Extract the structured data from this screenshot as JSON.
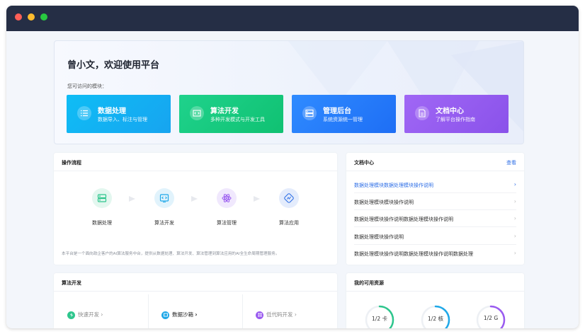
{
  "welcome": {
    "greeting": "曾小文，欢迎使用平台",
    "modules_label": "您可访问的模块："
  },
  "modules": [
    {
      "title": "数据处理",
      "desc": "数据导入、标注与管理",
      "icon": "list-icon"
    },
    {
      "title": "算法开发",
      "desc": "多种开发模式与开发工具",
      "icon": "code-icon"
    },
    {
      "title": "管理后台",
      "desc": "系统资源统一管理",
      "icon": "server-icon"
    },
    {
      "title": "文档中心",
      "desc": "了解平台操作指南",
      "icon": "document-icon"
    }
  ],
  "flow": {
    "title": "操作流程",
    "steps": [
      {
        "label": "数据处理",
        "icon": "server-icon",
        "color": "#2ec68d"
      },
      {
        "label": "算法开发",
        "icon": "code-icon",
        "color": "#1fa8e8"
      },
      {
        "label": "算法管理",
        "icon": "atom-icon",
        "color": "#9a5bf0"
      },
      {
        "label": "算法应用",
        "icon": "link-icon",
        "color": "#2f6fe6"
      }
    ],
    "description": "本平台是一个面向政企客户的AI算法服务中台，提供从数据处理、算法开发、算法管理到算法应用的AI全生命周期管理服务。"
  },
  "docs": {
    "title": "文档中心",
    "more": "查看",
    "items": [
      "数据处理模块数据处理模块操作说明",
      "数据处理模块模块操作说明",
      "数据处理模块操作说明数据处理模块操作说明",
      "数据处理模块操作说明",
      "数据处理模块操作说明数据处理模块操作说明数据处理"
    ]
  },
  "algo": {
    "title": "算法开发",
    "items": [
      {
        "label": "快速开发",
        "chevron": "›",
        "color": "#2ec68d",
        "icon": "flash-icon",
        "active": false
      },
      {
        "label": "数据沙箱",
        "chevron": "›",
        "color": "#1fa8e8",
        "icon": "sandbox-icon",
        "active": true
      },
      {
        "label": "低代码开发",
        "chevron": "›",
        "color": "#9a5bf0",
        "icon": "lowcode-icon",
        "active": false
      }
    ]
  },
  "resources": {
    "title": "我的可用资源",
    "items": [
      {
        "value": "1/2",
        "unit": "卡",
        "fraction": 0.5,
        "color": "#2ec68d"
      },
      {
        "value": "1/2",
        "unit": "核",
        "fraction": 0.5,
        "color": "#1fa8e8"
      },
      {
        "value": "1/2",
        "unit": "G",
        "fraction": 0.5,
        "color": "#9a5bf0"
      }
    ]
  }
}
